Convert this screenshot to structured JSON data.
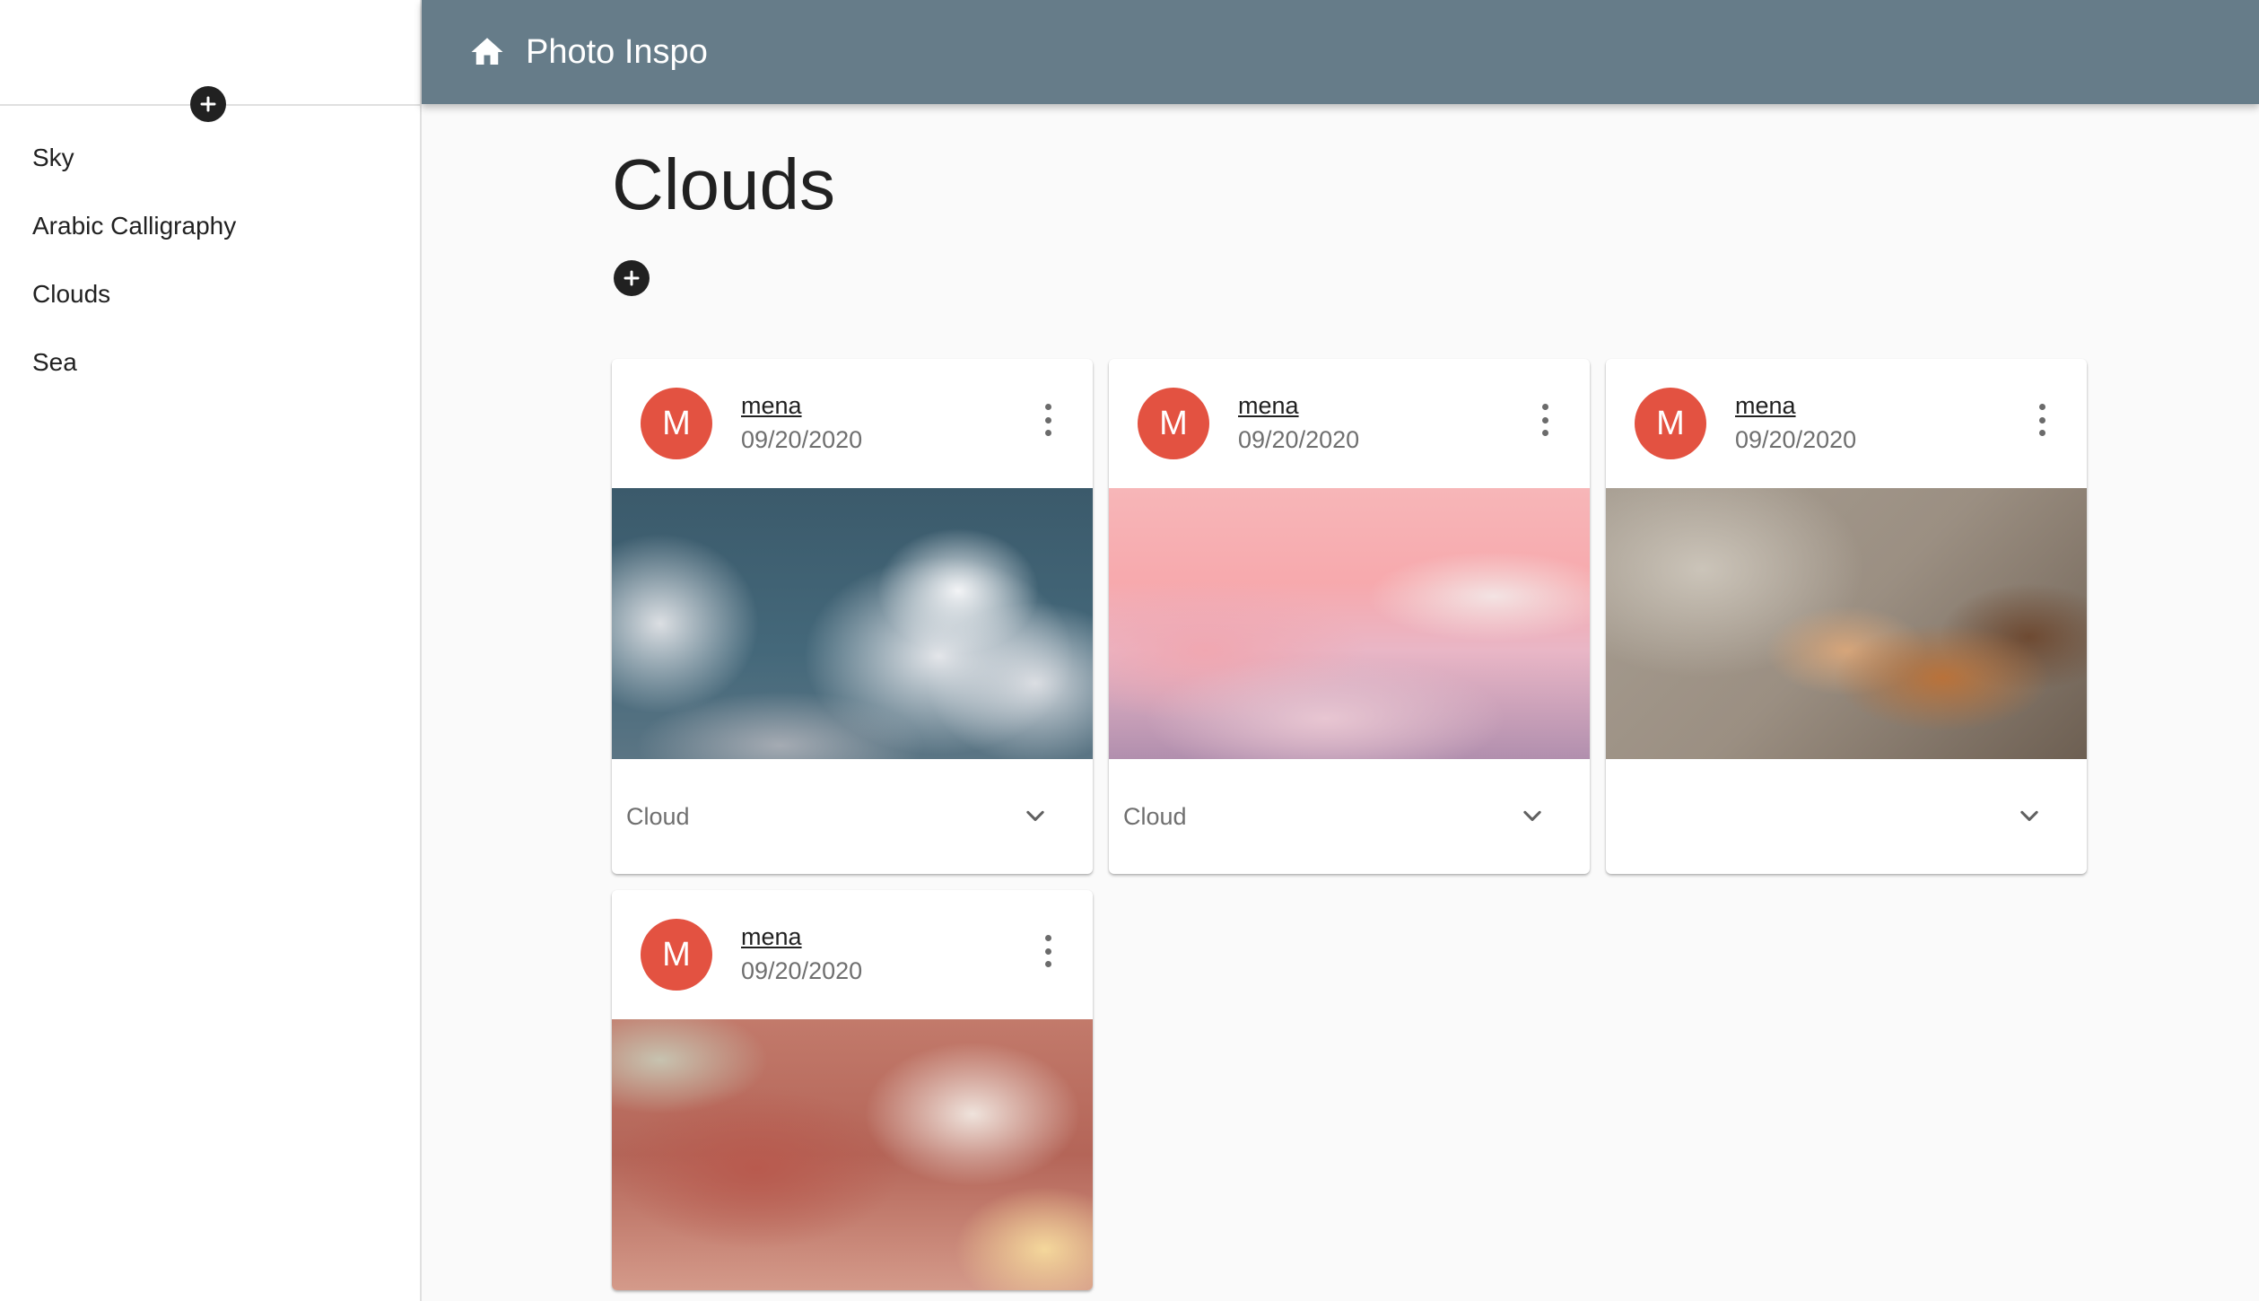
{
  "app": {
    "title": "Photo Inspo"
  },
  "sidebar": {
    "items": [
      {
        "label": "Sky"
      },
      {
        "label": "Arabic Calligraphy"
      },
      {
        "label": "Clouds"
      },
      {
        "label": "Sea"
      }
    ]
  },
  "main": {
    "title": "Clouds"
  },
  "cards": [
    {
      "avatar": "M",
      "user": "mena",
      "date": "09/20/2020",
      "caption": "Cloud"
    },
    {
      "avatar": "M",
      "user": "mena",
      "date": "09/20/2020",
      "caption": "Cloud"
    },
    {
      "avatar": "M",
      "user": "mena",
      "date": "09/20/2020",
      "caption": ""
    },
    {
      "avatar": "M",
      "user": "mena",
      "date": "09/20/2020",
      "caption": ""
    }
  ],
  "colors": {
    "appbar": "#667c89",
    "avatar": "#e35241",
    "background": "#fafafa"
  },
  "icons": {
    "home": "home-icon",
    "add": "add-circle-icon",
    "more": "more-vert-icon",
    "expand": "chevron-down-icon"
  }
}
